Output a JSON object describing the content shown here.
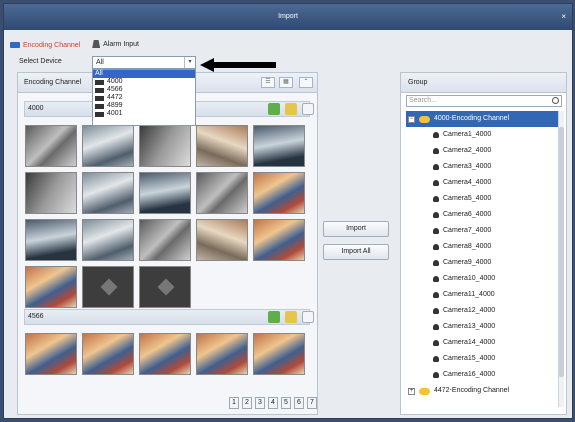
{
  "window": {
    "title": "Import",
    "close_symbol": "×"
  },
  "tabs": [
    {
      "label": "Encoding Channel",
      "active": true,
      "icon": "camera-icon"
    },
    {
      "label": "Alarm Input",
      "active": false,
      "icon": "alarm-input-icon"
    }
  ],
  "device_select": {
    "label": "Select Device",
    "value": "All",
    "options": [
      "All",
      "4000",
      "4566",
      "4472",
      "4899",
      "4001"
    ]
  },
  "left_panel": {
    "title": "Encoding Channel",
    "groups": [
      {
        "name": "4000",
        "thumbs": [
          "a",
          "b",
          "c",
          "d",
          "e",
          "c",
          "b",
          "e",
          "a",
          "col",
          "e",
          "b",
          "a",
          "d",
          "col",
          "col",
          "nosig",
          "nosig"
        ]
      },
      {
        "name": "4566",
        "thumbs": [
          "col",
          "col",
          "col",
          "col",
          "col"
        ]
      }
    ],
    "pages": [
      "1",
      "2",
      "3",
      "4",
      "5",
      "6",
      "7"
    ]
  },
  "buttons": {
    "import": "Import",
    "import_all": "Import All"
  },
  "right_panel": {
    "title": "Group",
    "search_placeholder": "Search...",
    "root": "4000-Encoding Channel",
    "cameras": [
      "Camera1_4000",
      "Camera2_4000",
      "Camera3_4000",
      "Camera4_4000",
      "Camera5_4000",
      "Camera6_4000",
      "Camera7_4000",
      "Camera8_4000",
      "Camera9_4000",
      "Camera10_4000",
      "Camera11_4000",
      "Camera12_4000",
      "Camera13_4000",
      "Camera14_4000",
      "Camera15_4000",
      "Camera16_4000"
    ],
    "root2": "4472-Encoding Channel"
  },
  "colors": {
    "titlebar": "#3d5a84",
    "accent": "#d8392f",
    "selection": "#3167b4"
  }
}
